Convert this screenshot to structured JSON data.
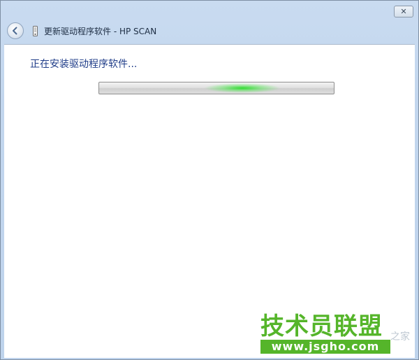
{
  "window": {
    "close_label": "✕",
    "title": "更新驱动程序软件 - HP SCAN"
  },
  "icons": {
    "back": "back-arrow-icon",
    "device": "device-icon",
    "close": "close-icon"
  },
  "main": {
    "heading": "正在安装驱动程序软件...",
    "progress": {
      "state": "indeterminate"
    }
  },
  "watermark": {
    "brand": "技术员联盟",
    "url": "www.jsgho.com",
    "tail": "之家"
  },
  "colors": {
    "heading": "#1f3c88",
    "progress_glow": "#28dc28",
    "watermark": "#55b52a"
  }
}
